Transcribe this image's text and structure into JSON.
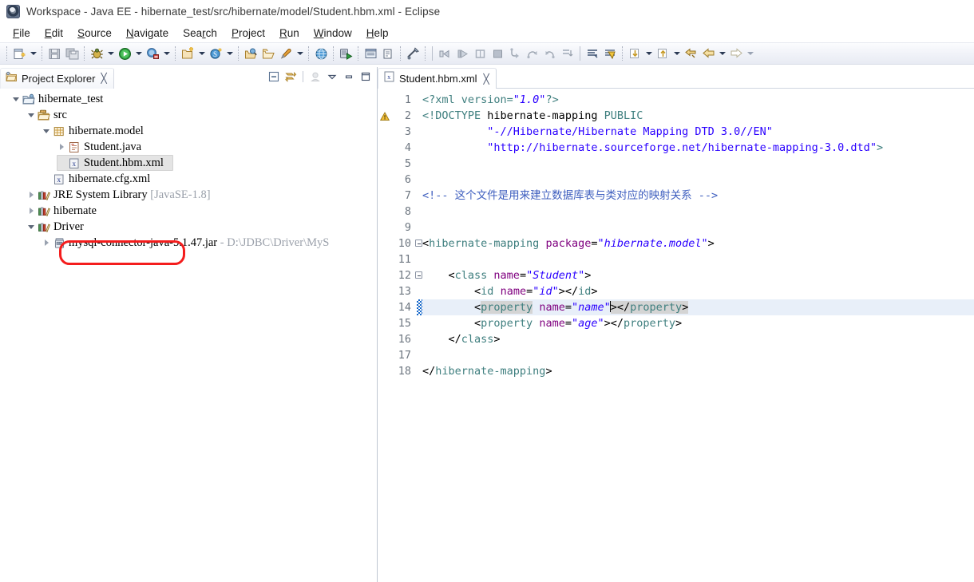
{
  "window": {
    "title": "Workspace - Java EE - hibernate_test/src/hibernate/model/Student.hbm.xml - Eclipse",
    "app_icon": "eclipse-icon"
  },
  "menubar": {
    "items": [
      {
        "label": "File",
        "mnemonic": "F"
      },
      {
        "label": "Edit",
        "mnemonic": "E"
      },
      {
        "label": "Source",
        "mnemonic": "S"
      },
      {
        "label": "Navigate",
        "mnemonic": "N"
      },
      {
        "label": "Search",
        "mnemonic": "r"
      },
      {
        "label": "Project",
        "mnemonic": "P"
      },
      {
        "label": "Run",
        "mnemonic": "R"
      },
      {
        "label": "Window",
        "mnemonic": "W"
      },
      {
        "label": "Help",
        "mnemonic": "H"
      }
    ]
  },
  "toolbar": {
    "items": [
      {
        "name": "new-wizard-icon",
        "type": "button"
      },
      {
        "name": "new-wizard-dropdown-icon",
        "type": "dropdown"
      },
      {
        "name": "save-icon",
        "type": "button"
      },
      {
        "name": "save-all-icon",
        "type": "button"
      },
      {
        "name": "debug-icon",
        "type": "button"
      },
      {
        "name": "debug-dropdown-icon",
        "type": "dropdown"
      },
      {
        "name": "run-icon",
        "type": "button"
      },
      {
        "name": "run-dropdown-icon",
        "type": "dropdown"
      },
      {
        "name": "run-external-tools-icon",
        "type": "button"
      },
      {
        "name": "run-external-tools-dropdown-icon",
        "type": "dropdown"
      },
      {
        "name": "new-java-package-icon",
        "type": "button"
      },
      {
        "name": "new-java-package-dropdown-icon",
        "type": "dropdown"
      },
      {
        "name": "new-servlet-icon",
        "type": "button"
      },
      {
        "name": "new-servlet-dropdown-icon",
        "type": "dropdown"
      },
      {
        "name": "open-type-icon",
        "type": "button"
      },
      {
        "name": "open-resource-icon",
        "type": "button"
      },
      {
        "name": "quick-access-icon",
        "type": "button"
      },
      {
        "name": "quick-access-dropdown-icon",
        "type": "dropdown"
      },
      {
        "name": "web-browser-icon",
        "type": "button"
      },
      {
        "name": "run-on-server-icon",
        "type": "button"
      },
      {
        "name": "java-browsing-icon",
        "type": "button"
      },
      {
        "name": "open-task-icon",
        "type": "button"
      },
      {
        "name": "terminal-icon",
        "type": "button"
      },
      {
        "name": "toggle-breakpoint-icon",
        "type": "button"
      },
      {
        "name": "resume-icon",
        "type": "button"
      },
      {
        "name": "suspend-icon",
        "type": "button"
      },
      {
        "name": "terminate-icon",
        "type": "button"
      },
      {
        "name": "step-into-icon",
        "type": "button"
      },
      {
        "name": "step-over-icon",
        "type": "button"
      },
      {
        "name": "step-return-icon",
        "type": "button"
      },
      {
        "name": "drop-to-frame-icon",
        "type": "button"
      },
      {
        "name": "search-icon",
        "type": "button"
      },
      {
        "name": "search-references-icon",
        "type": "button"
      },
      {
        "name": "next-annotation-icon",
        "type": "button"
      },
      {
        "name": "next-annotation-dropdown-icon",
        "type": "dropdown"
      },
      {
        "name": "previous-annotation-icon",
        "type": "button"
      },
      {
        "name": "previous-annotation-dropdown-icon",
        "type": "dropdown"
      },
      {
        "name": "last-edit-location-icon",
        "type": "button"
      },
      {
        "name": "back-icon",
        "type": "button"
      },
      {
        "name": "back-dropdown-icon",
        "type": "dropdown"
      },
      {
        "name": "forward-icon",
        "type": "button"
      },
      {
        "name": "forward-dropdown-icon",
        "type": "dropdown"
      }
    ]
  },
  "explorer": {
    "tab_label": "Project Explorer",
    "tab_close": "╳",
    "view_tools": [
      {
        "name": "collapse-all-icon"
      },
      {
        "name": "link-with-editor-icon"
      },
      {
        "name": "focus-on-active-task-icon"
      },
      {
        "name": "view-menu-icon"
      },
      {
        "name": "minimize-view-icon"
      },
      {
        "name": "maximize-view-icon"
      }
    ],
    "tree": [
      {
        "label": "hibernate_test",
        "icon": "java-project-icon",
        "indent": 0,
        "twisty": "expanded",
        "selected": false,
        "suffix": ""
      },
      {
        "label": "src",
        "icon": "source-folder-icon",
        "indent": 1,
        "twisty": "expanded",
        "selected": false,
        "suffix": ""
      },
      {
        "label": "hibernate.model",
        "icon": "package-icon",
        "indent": 2,
        "twisty": "expanded",
        "selected": false,
        "suffix": ""
      },
      {
        "label": "Student.java",
        "icon": "java-file-icon",
        "indent": 3,
        "twisty": "collapsed",
        "selected": false,
        "suffix": ""
      },
      {
        "label": "Student.hbm.xml",
        "icon": "xml-file-icon",
        "indent": 3,
        "twisty": "none",
        "selected": true,
        "suffix": ""
      },
      {
        "label": "hibernate.cfg.xml",
        "icon": "xml-file-icon",
        "indent": 2,
        "twisty": "none",
        "selected": false,
        "suffix": ""
      },
      {
        "label": "JRE System Library",
        "icon": "library-icon",
        "indent": 1,
        "twisty": "collapsed",
        "selected": false,
        "suffix": "[JavaSE-1.8]"
      },
      {
        "label": "hibernate",
        "icon": "library-icon",
        "indent": 1,
        "twisty": "collapsed",
        "selected": false,
        "suffix": ""
      },
      {
        "label": "Driver",
        "icon": "library-icon",
        "indent": 1,
        "twisty": "expanded",
        "selected": false,
        "suffix": ""
      },
      {
        "label": "mysql-connector-java-5.1.47.jar",
        "icon": "jar-icon",
        "indent": 2,
        "twisty": "collapsed",
        "selected": false,
        "suffix": "- D:\\JDBC\\Driver\\MyS"
      }
    ],
    "highlight": {
      "name": "red-annotation-box",
      "color": "#f41d1d"
    }
  },
  "editor": {
    "tab": {
      "label": "Student.hbm.xml",
      "icon": "xml-file-icon",
      "close": "╳"
    },
    "current_line": 14,
    "total_lines": 18,
    "annotations": [
      {
        "line": 2,
        "type": "warning-marker"
      }
    ],
    "change_markers": [
      14
    ],
    "fold_markers": [
      10,
      12
    ],
    "lines": [
      {
        "n": 1,
        "tokens": [
          {
            "t": "<?xml version=",
            "c": "pi"
          },
          {
            "t": "\"1.0\"",
            "c": "str"
          },
          {
            "t": "?>",
            "c": "pi"
          }
        ]
      },
      {
        "n": 2,
        "tokens": [
          {
            "t": "<!DOCTYPE ",
            "c": "dtd"
          },
          {
            "t": "hibernate-mapping",
            "c": "dtdname"
          },
          {
            "t": " PUBLIC",
            "c": "dtd"
          }
        ]
      },
      {
        "n": 3,
        "tokens": [
          {
            "t": "          ",
            "c": "punct"
          },
          {
            "t": "\"-//Hibernate/Hibernate Mapping DTD 3.0//EN\"",
            "c": "dq"
          }
        ]
      },
      {
        "n": 4,
        "tokens": [
          {
            "t": "          ",
            "c": "punct"
          },
          {
            "t": "\"http://hibernate.sourceforge.net/hibernate-mapping-3.0.dtd\"",
            "c": "dq"
          },
          {
            "t": ">",
            "c": "dtd"
          }
        ]
      },
      {
        "n": 5,
        "tokens": []
      },
      {
        "n": 6,
        "tokens": []
      },
      {
        "n": 7,
        "tokens": [
          {
            "t": "<!-- 这个文件是用来建立数据库表与类对应的映射关系 -->",
            "c": "com"
          }
        ]
      },
      {
        "n": 8,
        "tokens": []
      },
      {
        "n": 9,
        "tokens": []
      },
      {
        "n": 10,
        "tokens": [
          {
            "t": "<",
            "c": "punct"
          },
          {
            "t": "hibernate-mapping",
            "c": "tag"
          },
          {
            "t": " ",
            "c": "punct"
          },
          {
            "t": "package",
            "c": "attr"
          },
          {
            "t": "=",
            "c": "punct"
          },
          {
            "t": "\"hibernate.model\"",
            "c": "val"
          },
          {
            "t": ">",
            "c": "punct"
          }
        ]
      },
      {
        "n": 11,
        "tokens": []
      },
      {
        "n": 12,
        "tokens": [
          {
            "t": "    <",
            "c": "punct"
          },
          {
            "t": "class",
            "c": "tag"
          },
          {
            "t": " ",
            "c": "punct"
          },
          {
            "t": "name",
            "c": "attr"
          },
          {
            "t": "=",
            "c": "punct"
          },
          {
            "t": "\"Student\"",
            "c": "val"
          },
          {
            "t": ">",
            "c": "punct"
          }
        ]
      },
      {
        "n": 13,
        "tokens": [
          {
            "t": "        <",
            "c": "punct"
          },
          {
            "t": "id",
            "c": "tag"
          },
          {
            "t": " ",
            "c": "punct"
          },
          {
            "t": "name",
            "c": "attr"
          },
          {
            "t": "=",
            "c": "punct"
          },
          {
            "t": "\"id\"",
            "c": "val"
          },
          {
            "t": "></",
            "c": "punct"
          },
          {
            "t": "id",
            "c": "tag"
          },
          {
            "t": ">",
            "c": "punct"
          }
        ]
      },
      {
        "n": 14,
        "tokens": [
          {
            "t": "        <",
            "c": "punct"
          },
          {
            "t": "property",
            "c": "tag occ"
          },
          {
            "t": " ",
            "c": "punct"
          },
          {
            "t": "name",
            "c": "attr"
          },
          {
            "t": "=",
            "c": "punct"
          },
          {
            "t": "\"name\"",
            "c": "val"
          },
          {
            "t": "CARET",
            "c": "caret"
          },
          {
            "t": "></",
            "c": "punct occ"
          },
          {
            "t": "property",
            "c": "tag occ"
          },
          {
            "t": ">",
            "c": "punct occ"
          }
        ]
      },
      {
        "n": 15,
        "tokens": [
          {
            "t": "        <",
            "c": "punct"
          },
          {
            "t": "property",
            "c": "tag"
          },
          {
            "t": " ",
            "c": "punct"
          },
          {
            "t": "name",
            "c": "attr"
          },
          {
            "t": "=",
            "c": "punct"
          },
          {
            "t": "\"age\"",
            "c": "val"
          },
          {
            "t": "></",
            "c": "punct"
          },
          {
            "t": "property",
            "c": "tag"
          },
          {
            "t": ">",
            "c": "punct"
          }
        ]
      },
      {
        "n": 16,
        "tokens": [
          {
            "t": "    </",
            "c": "punct"
          },
          {
            "t": "class",
            "c": "tag"
          },
          {
            "t": ">",
            "c": "punct"
          }
        ]
      },
      {
        "n": 17,
        "tokens": []
      },
      {
        "n": 18,
        "tokens": [
          {
            "t": "</",
            "c": "punct"
          },
          {
            "t": "hibernate-mapping",
            "c": "tag"
          },
          {
            "t": ">",
            "c": "punct"
          }
        ]
      }
    ]
  },
  "colors": {
    "accent": "#2a00ff",
    "tag": "#3f7f7f",
    "attribute": "#7f007f",
    "comment": "#3f5fbf",
    "current_line_bg": "#e8eff9",
    "selection_bg": "#e4e4e4",
    "annotation_red": "#f41d1d",
    "change_marker": "#1667c9"
  }
}
